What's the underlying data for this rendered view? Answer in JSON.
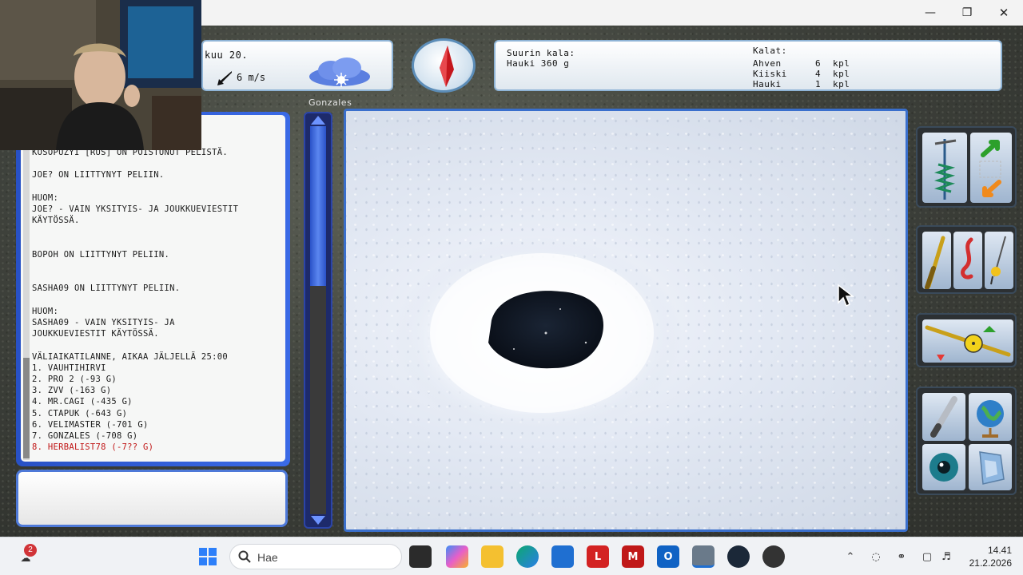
{
  "window": {
    "minimize_icon": "minimize-icon",
    "maximize_icon": "restore-icon",
    "close_icon": "close-icon"
  },
  "weather": {
    "day": "kuu 20.",
    "wind_speed": "6 m/s",
    "condition_icon": "cloud-sun-icon"
  },
  "biggest_fish": {
    "label": "Suurin kala:",
    "value": "Hauki 360 g"
  },
  "catch": {
    "title": "Kalat:",
    "rows": [
      {
        "name": "Ahven",
        "count": "6",
        "unit": "kpl"
      },
      {
        "name": "Kiiski",
        "count": "4",
        "unit": "kpl"
      },
      {
        "name": "Hauki",
        "count": "1",
        "unit": "kpl"
      }
    ]
  },
  "player": {
    "name": "Gonzales"
  },
  "chat": {
    "lines": [
      {
        "text": "KOSOPUZYI [RUS] ON POISTUNUT PELISTÄ.",
        "style": "normal"
      },
      {
        "text": "",
        "style": "normal"
      },
      {
        "text": "JOE? ON LIITTYNYT PELIIN.",
        "style": "normal"
      },
      {
        "text": "",
        "style": "normal"
      },
      {
        "text": "HUOM:",
        "style": "normal"
      },
      {
        "text": "JOE? - VAIN YKSITYIS- JA JOUKKUEVIESTIT",
        "style": "normal"
      },
      {
        "text": "KÄYTÖSSÄ.",
        "style": "normal"
      },
      {
        "text": "",
        "style": "normal"
      },
      {
        "text": "",
        "style": "normal"
      },
      {
        "text": "BOPOH ON LIITTYNYT PELIIN.",
        "style": "normal"
      },
      {
        "text": "",
        "style": "normal"
      },
      {
        "text": "",
        "style": "normal"
      },
      {
        "text": "SASHA09 ON LIITTYNYT PELIIN.",
        "style": "normal"
      },
      {
        "text": "",
        "style": "normal"
      },
      {
        "text": "HUOM:",
        "style": "normal"
      },
      {
        "text": "SASHA09 - VAIN YKSITYIS- JA",
        "style": "normal"
      },
      {
        "text": "JOUKKUEVIESTIT KÄYTÖSSÄ.",
        "style": "normal"
      },
      {
        "text": "",
        "style": "normal"
      },
      {
        "text": "VÄLIAIKATILANNE, AIKAA JÄLJELLÄ 25:00",
        "style": "normal"
      },
      {
        "text": "1. VAUHTIHIRVI",
        "style": "normal"
      },
      {
        "text": "2. PRO 2 (-93 G)",
        "style": "normal"
      },
      {
        "text": "3. ZVV (-163 G)",
        "style": "normal"
      },
      {
        "text": "4. MR.CAGI (-435 G)",
        "style": "normal"
      },
      {
        "text": "5. CTAPUK (-643 G)",
        "style": "normal"
      },
      {
        "text": "6. VELIMASTER (-701 G)",
        "style": "normal"
      },
      {
        "text": "7. GONZALES (-708 G)",
        "style": "normal"
      },
      {
        "text": "8. HERBALIST78 (-7?? G)",
        "style": "red"
      }
    ]
  },
  "tools": {
    "drill_icon": "ice-drill-icon",
    "up_arrow_icon": "arrow-up-icon",
    "down_arrow_icon": "arrow-down-icon",
    "rod_icon": "fishing-rod-icon",
    "bait_icon": "bait-icon",
    "jig_icon": "jig-icon",
    "reel_icon": "reel-rod-icon",
    "knife_icon": "knife-icon",
    "globe_icon": "globe-icon",
    "eye_icon": "eye-icon",
    "map_icon": "map-icon"
  },
  "taskbar": {
    "notification_count": "2",
    "search_placeholder": "Hae",
    "time": "14.41",
    "date": "21.2.2026",
    "pinned_apps": [
      {
        "name": "file-explorer-icon"
      },
      {
        "name": "copilot-icon"
      },
      {
        "name": "folder-icon"
      },
      {
        "name": "edge-icon"
      },
      {
        "name": "store-icon"
      },
      {
        "name": "lastpass-icon"
      },
      {
        "name": "mcafee-icon"
      },
      {
        "name": "outlook-icon"
      },
      {
        "name": "game-icon"
      },
      {
        "name": "steam-icon"
      },
      {
        "name": "record-icon"
      }
    ]
  }
}
